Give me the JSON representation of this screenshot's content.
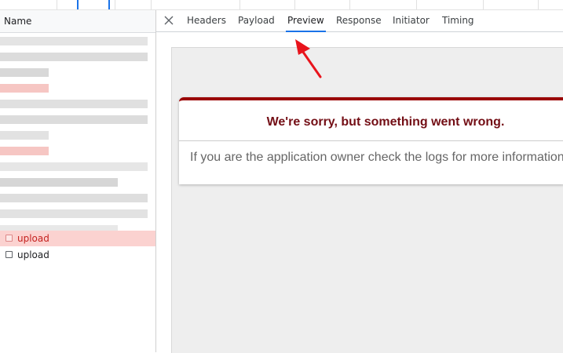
{
  "network_panel": {
    "column_header": "Name",
    "requests": [
      {
        "name": "upload",
        "state": "error"
      },
      {
        "name": "upload",
        "state": "normal"
      }
    ]
  },
  "details": {
    "close_icon": "close-icon",
    "tabs": [
      {
        "label": "Headers"
      },
      {
        "label": "Payload"
      },
      {
        "label": "Preview"
      },
      {
        "label": "Response"
      },
      {
        "label": "Initiator"
      },
      {
        "label": "Timing"
      }
    ],
    "active_tab": "Preview"
  },
  "preview": {
    "error_title": "We're sorry, but something went wrong.",
    "error_message": "If you are the application owner check the logs for more information."
  },
  "colors": {
    "accent": "#1a73e8",
    "error_row": "#fbd2d0",
    "error_text": "#730e15",
    "annotation_arrow": "#e8141c"
  }
}
